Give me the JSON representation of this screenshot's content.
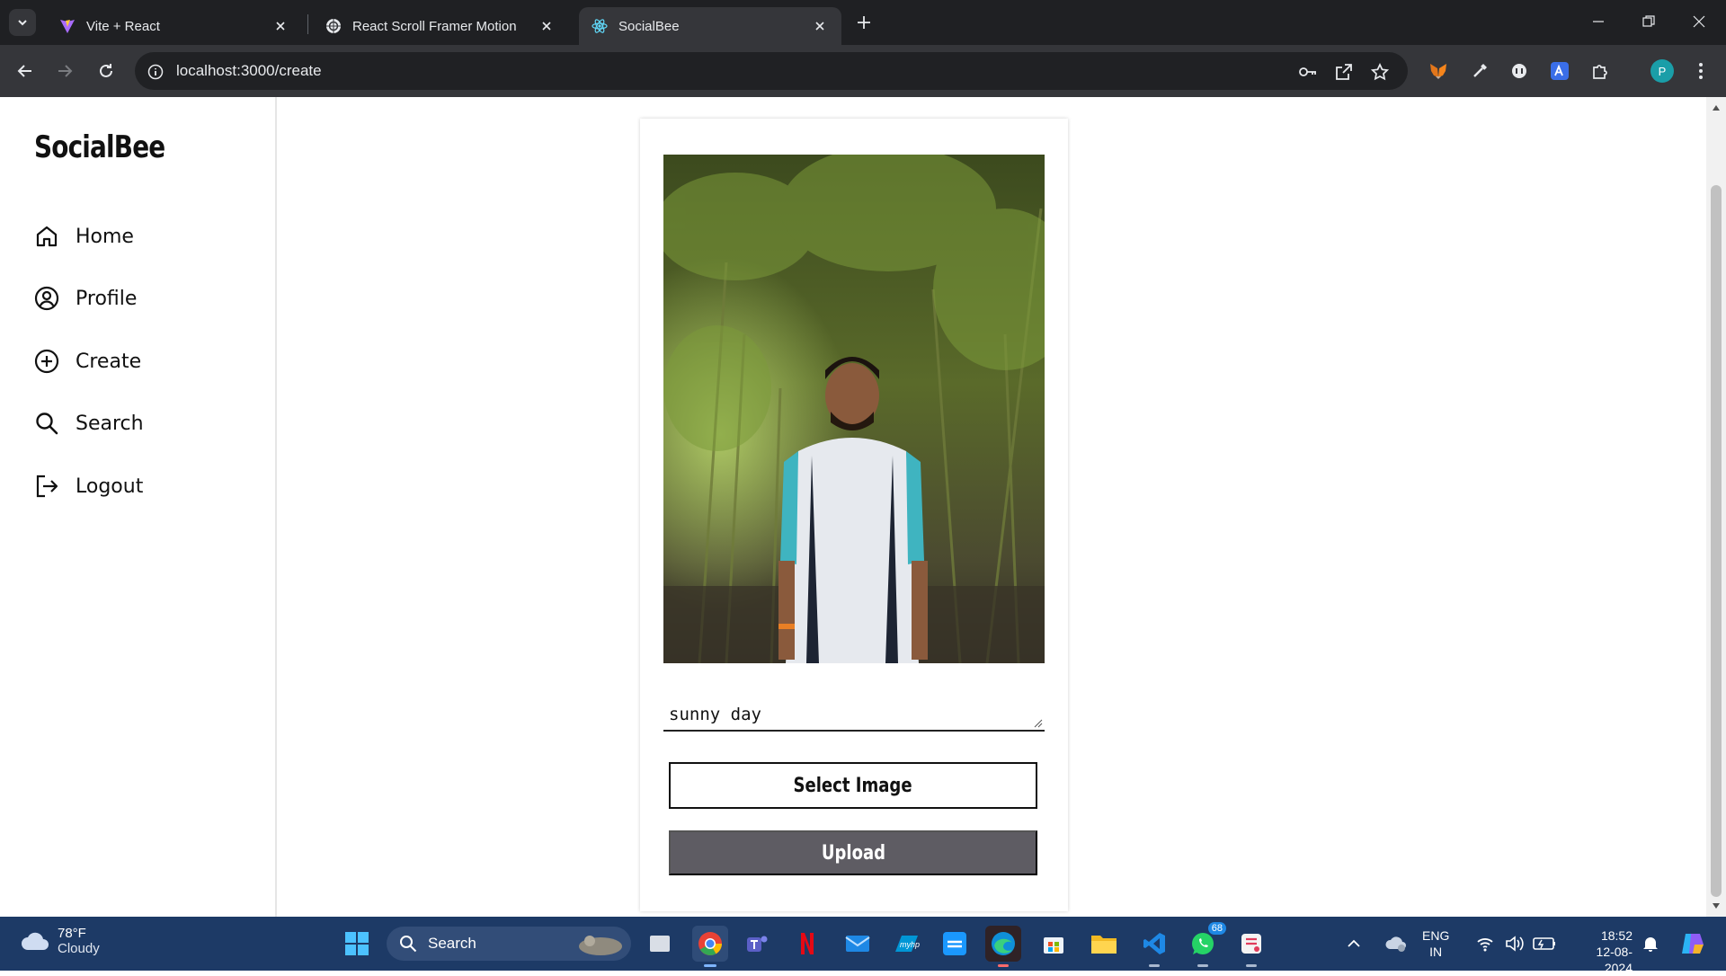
{
  "browser": {
    "tabs": [
      {
        "title": "Vite + React",
        "icon": "vite-logo-icon",
        "active": false
      },
      {
        "title": "React Scroll Framer Motion",
        "icon": "openai-logo-icon",
        "active": false
      },
      {
        "title": "SocialBee",
        "icon": "react-logo-icon",
        "active": true
      }
    ],
    "url": "localhost:3000/create",
    "profile_initial": "P"
  },
  "app": {
    "brand": "SocialBee",
    "nav": [
      {
        "label": "Home",
        "icon": "home-icon"
      },
      {
        "label": "Profile",
        "icon": "user-circle-icon"
      },
      {
        "label": "Create",
        "icon": "plus-circle-icon"
      },
      {
        "label": "Search",
        "icon": "search-icon"
      },
      {
        "label": "Logout",
        "icon": "logout-icon"
      }
    ],
    "create": {
      "caption_value": "sunny day",
      "select_button": "Select Image",
      "upload_button": "Upload"
    }
  },
  "taskbar": {
    "weather_temp": "78°F",
    "weather_desc": "Cloudy",
    "search_label": "Search",
    "lang_top": "ENG",
    "lang_bottom": "IN",
    "time": "18:52",
    "date": "12-08-2024",
    "whatsapp_badge": "68"
  },
  "colors": {
    "upload_button_bg": "#5e5c63",
    "taskbar_bg": "#1d3a66",
    "chrome_bg": "#35363a"
  }
}
